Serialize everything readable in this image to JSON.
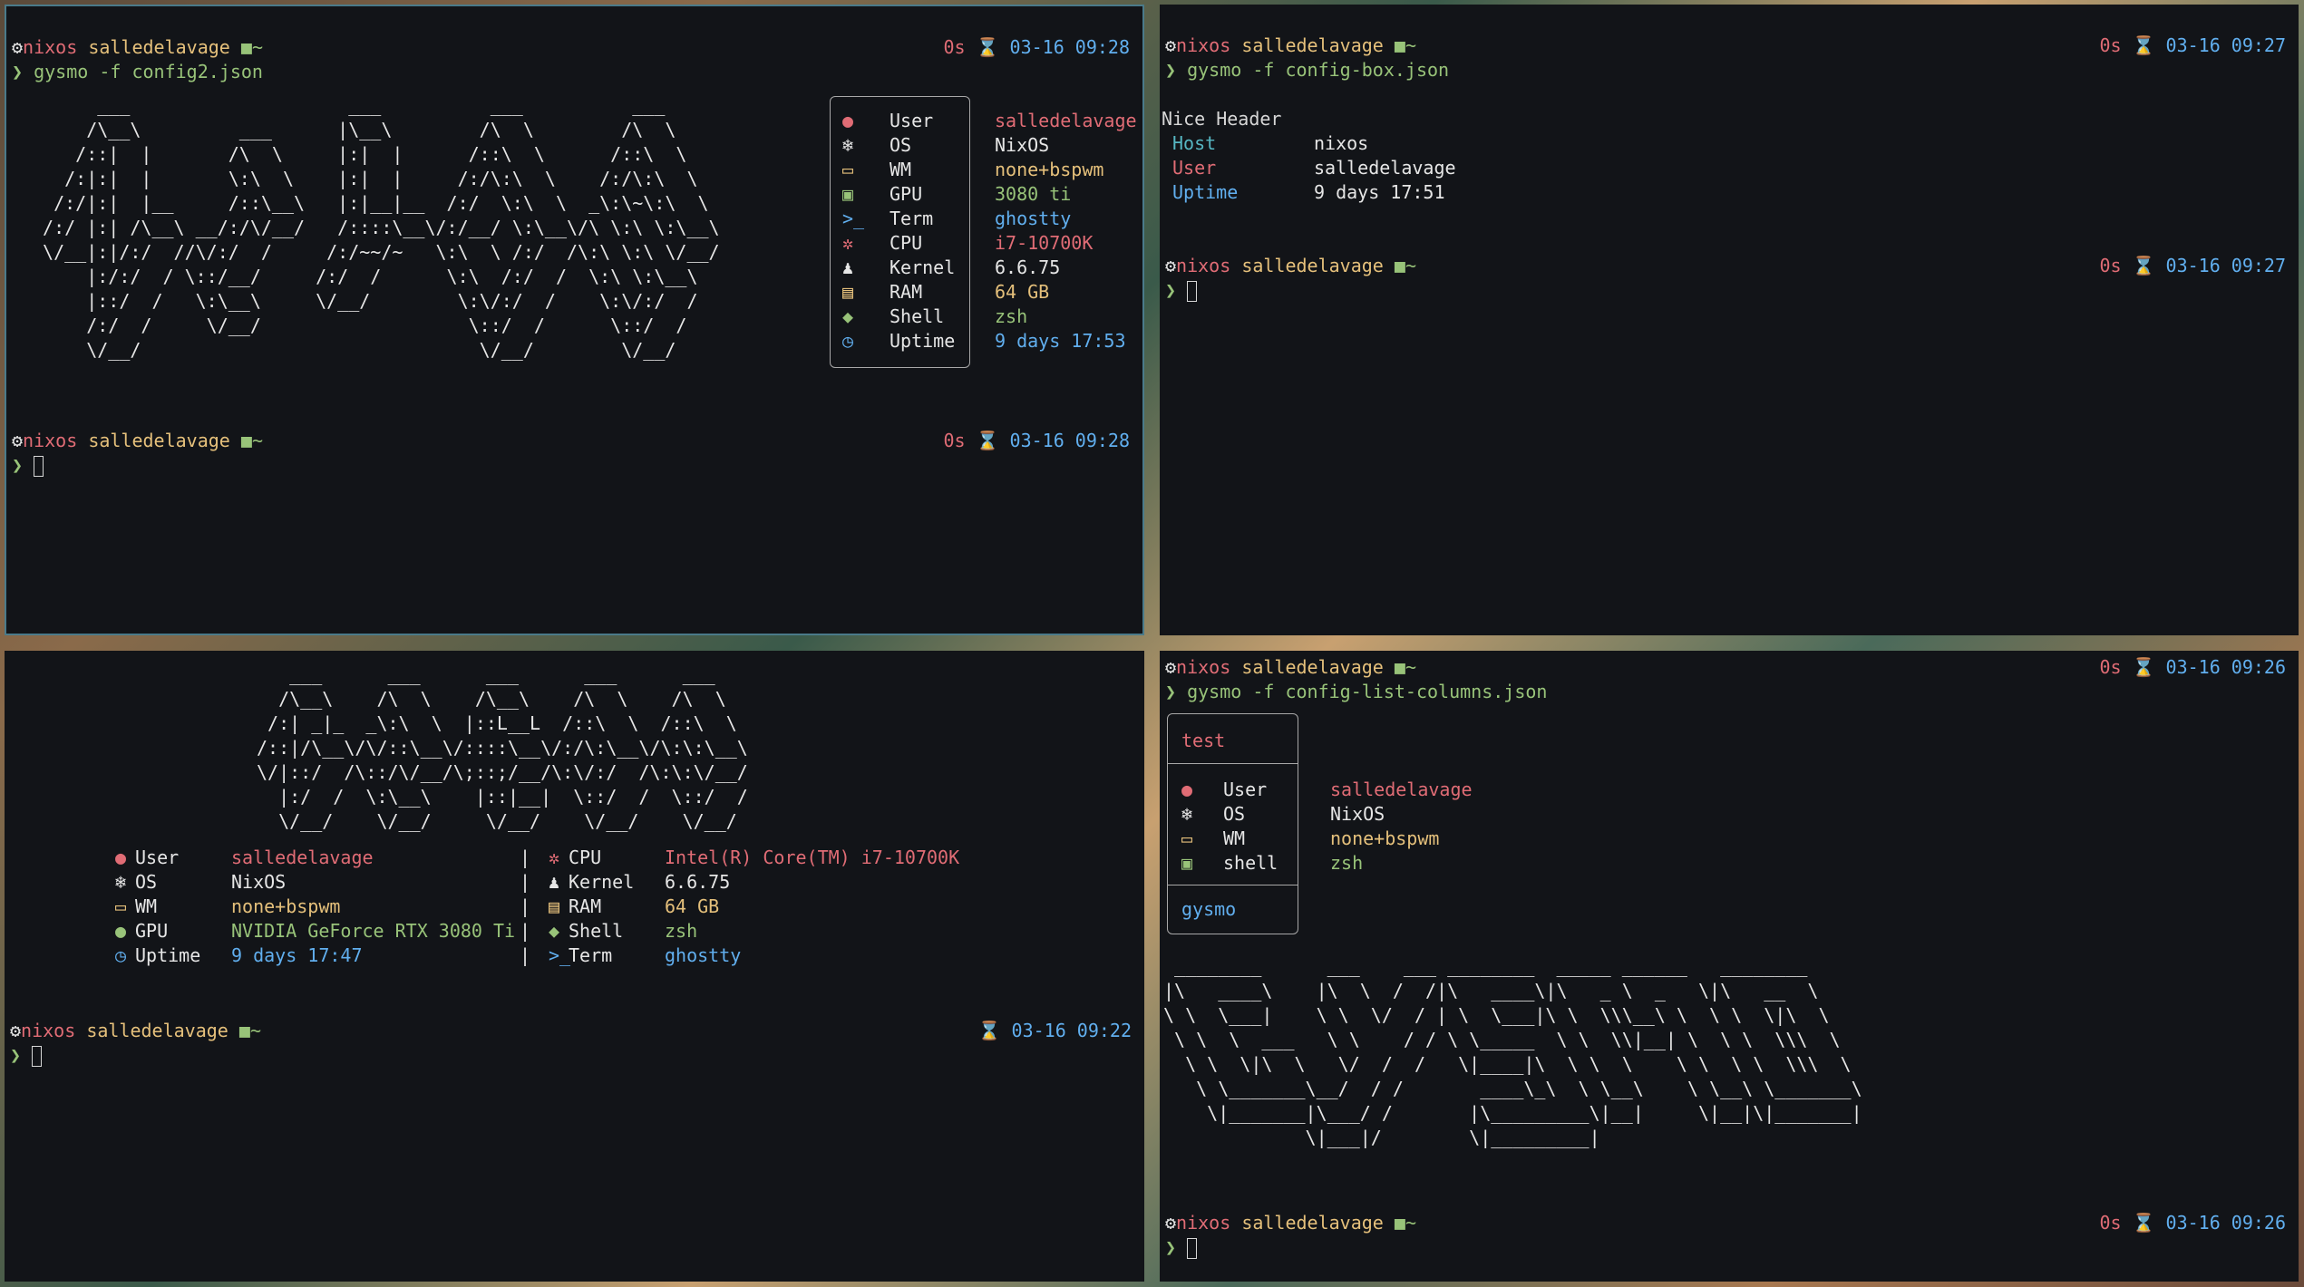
{
  "prompt": {
    "host": "nixos",
    "user": "salledelavage",
    "dir_icon": "folder-icon",
    "dir": "~",
    "chevron": "❯",
    "gear": "⚙"
  },
  "tl": {
    "cmd": "gysmo -f config2.json",
    "time": "0s",
    "date": "⌛ 03-16 09:28",
    "ascii": "      ___                    ___          ___          ___    \n     /\\__\\         ___      |\\__\\        /\\  \\        /\\  \\   \n    /::|  |       /\\  \\     |:|  |      /::\\  \\      /::\\  \\  \n   /:|:|  |       \\:\\  \\    |:|  |     /:/\\:\\  \\    /:/\\:\\  \\ \n  /:/|:|  |__     /::\\__\\   |:|__|__  /:/  \\:\\  \\  _\\:\\~\\:\\  \\\n /:/ |:| /\\__\\ __/:/\\/__/   /::::\\__\\/:/__/ \\:\\__\\/\\ \\:\\ \\:\\__\\\n \\/__|:|/:/  //\\/:/  /     /:/~~/~   \\:\\  \\ /:/  /\\:\\ \\:\\ \\/__/\n     |:/:/  / \\::/__/     /:/  /      \\:\\  /:/  /  \\:\\ \\:\\__\\  \n     |::/  /   \\:\\__\\     \\/__/        \\:\\/:/  /    \\:\\/:/  /  \n     /:/  /     \\/__/                   \\::/  /      \\::/  /   \n     \\/__/                               \\/__/        \\/__/    ",
    "items": [
      {
        "icon": "user-icon",
        "glyph": "●",
        "label": "User",
        "value": "salledelavage",
        "color": "red"
      },
      {
        "icon": "nixos-icon",
        "glyph": "❄",
        "label": "OS",
        "value": "NixOS",
        "color": "white"
      },
      {
        "icon": "window-icon",
        "glyph": "▭",
        "label": "WM",
        "value": "none+bspwm",
        "color": "yellow"
      },
      {
        "icon": "gpu-icon",
        "glyph": "▣",
        "label": "GPU",
        "value": "3080 ti",
        "color": "green"
      },
      {
        "icon": "terminal-icon",
        "glyph": ">_",
        "label": "Term",
        "value": "ghostty",
        "color": "blue"
      },
      {
        "icon": "cpu-icon",
        "glyph": "✲",
        "label": "CPU",
        "value": "i7-10700K",
        "color": "red"
      },
      {
        "icon": "linux-icon",
        "glyph": "♟",
        "label": "Kernel",
        "value": "6.6.75",
        "color": "white"
      },
      {
        "icon": "ram-icon",
        "glyph": "▤",
        "label": "RAM",
        "value": "64 GB",
        "color": "yellow"
      },
      {
        "icon": "shell-icon",
        "glyph": "◆",
        "label": "Shell",
        "value": "zsh",
        "color": "green"
      },
      {
        "icon": "clock-icon",
        "glyph": "◷",
        "label": "Uptime",
        "value": "9 days 17:53",
        "color": "blue"
      }
    ],
    "prompt2_time": "0s",
    "prompt2_date": "⌛ 03-16 09:28"
  },
  "tr": {
    "time": "0s",
    "date": "⌛ 03-16 09:27",
    "cmd": "gysmo -f config-box.json",
    "header": "Nice Header",
    "rows": [
      {
        "label": "Host",
        "value": "nixos",
        "color": "cyan"
      },
      {
        "label": "User",
        "value": "salledelavage",
        "color": "red"
      },
      {
        "label": "Uptime",
        "value": "9 days 17:51",
        "color": "blue"
      }
    ],
    "prompt2_time": "0s",
    "prompt2_date": "⌛ 03-16 09:27"
  },
  "bl": {
    "ascii": "   ___      ___      ___      ___      ___   \n  /\\__\\    /\\  \\    /\\__\\    /\\  \\    /\\  \\  \n /:| _|_  _\\:\\  \\  |::L__L  /::\\  \\  /::\\  \\ \n/::|/\\__\\/\\/::\\__\\/::::\\__\\/:/\\:\\__\\/\\:\\:\\__\\\n\\/|::/  /\\::/\\/__/\\;::;/__/\\:\\/:/  /\\:\\:\\/__/\n  |:/  /  \\:\\__\\    |::|__|  \\::/  /  \\::/  / \n  \\/__/    \\/__/     \\/__/    \\/__/    \\/__/  ",
    "left": [
      {
        "icon": "user-icon",
        "glyph": "●",
        "label": "User",
        "value": "salledelavage",
        "color": "red"
      },
      {
        "icon": "nixos-icon",
        "glyph": "❄",
        "label": "OS",
        "value": "NixOS",
        "color": "white"
      },
      {
        "icon": "window-icon",
        "glyph": "▭",
        "label": "WM",
        "value": "none+bspwm",
        "color": "yellow"
      },
      {
        "icon": "gpu-icon",
        "glyph": "●",
        "label": "GPU",
        "value": "NVIDIA GeForce RTX 3080 Ti",
        "color": "green"
      },
      {
        "icon": "clock-icon",
        "glyph": "◷",
        "label": "Uptime",
        "value": "9 days 17:47",
        "color": "blue"
      }
    ],
    "right": [
      {
        "icon": "cpu-icon",
        "glyph": "✲",
        "label": "CPU",
        "value": "Intel(R) Core(TM) i7-10700K",
        "color": "red"
      },
      {
        "icon": "linux-icon",
        "glyph": "♟",
        "label": "Kernel",
        "value": "6.6.75",
        "color": "white"
      },
      {
        "icon": "ram-icon",
        "glyph": "▤",
        "label": "RAM",
        "value": "64 GB",
        "color": "yellow"
      },
      {
        "icon": "shell-icon",
        "glyph": "◆",
        "label": "Shell",
        "value": "zsh",
        "color": "green"
      },
      {
        "icon": "terminal-icon",
        "glyph": ">_",
        "label": "Term",
        "value": "ghostty",
        "color": "blue"
      }
    ],
    "divider": "|",
    "prompt2_date": "⌛ 03-16 09:22"
  },
  "br": {
    "time": "0s",
    "date": "⌛ 03-16 09:26",
    "cmd": "gysmo -f config-list-columns.json",
    "box_title": "test",
    "rows": [
      {
        "icon": "user-icon",
        "glyph": "●",
        "label": "User",
        "value": "salledelavage",
        "color": "red"
      },
      {
        "icon": "nixos-icon",
        "glyph": "❄",
        "label": "OS",
        "value": "NixOS",
        "color": "white"
      },
      {
        "icon": "window-icon",
        "glyph": "▭",
        "label": "WM",
        "value": "none+bspwm",
        "color": "yellow"
      },
      {
        "icon": "shell-icon",
        "glyph": "▣",
        "label": "shell",
        "value": "zsh",
        "color": "green"
      }
    ],
    "box_footer": "gysmo",
    "ascii": " ________      ___    ___ ________  _____ ______   ________     \n|\\   ____\\    |\\  \\  /  /|\\   ____\\|\\   _ \\  _   \\|\\   __  \\    \n\\ \\  \\___|    \\ \\  \\/  / | \\  \\___|\\ \\  \\\\\\__\\ \\  \\ \\  \\|\\  \\   \n \\ \\  \\  ___   \\ \\    / / \\ \\_____  \\ \\  \\\\|__| \\  \\ \\  \\\\\\  \\  \n  \\ \\  \\|\\  \\   \\/  /  /   \\|____|\\  \\ \\  \\    \\ \\  \\ \\  \\\\\\  \\ \n   \\ \\_______\\__/  / /       ____\\_\\  \\ \\__\\    \\ \\__\\ \\_______\\\n    \\|_______|\\___/ /       |\\_________\\|__|     \\|__|\\|_______|\n             \\|___|/        \\|_________|                        ",
    "prompt2_time": "0s",
    "prompt2_date": "⌛ 03-16 09:26"
  }
}
